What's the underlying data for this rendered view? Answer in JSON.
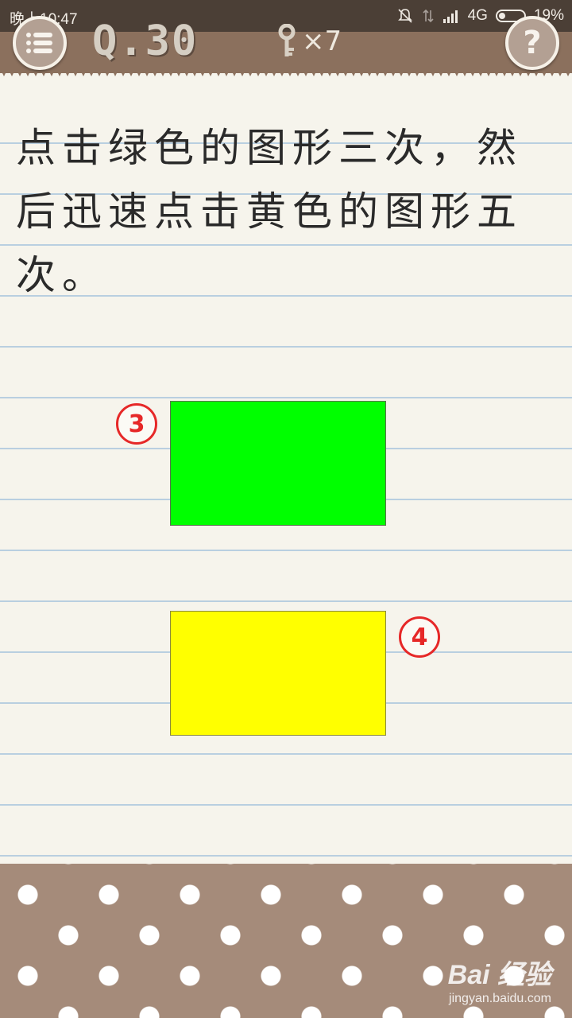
{
  "status_bar": {
    "time": "晚上10:47",
    "network": "4G",
    "battery": "19%",
    "icons": [
      "bell-muted-icon",
      "data-arrows-icon",
      "signal-icon",
      "battery-icon"
    ]
  },
  "header": {
    "level": "Q.30",
    "keys_count": "×7",
    "help_glyph": "?",
    "icons": [
      "menu-list-icon",
      "key-icon",
      "help-icon"
    ]
  },
  "question": {
    "text": "点击绿色的图形三次，然后迅速点击黄色的图形五次。"
  },
  "shapes": {
    "green": {
      "color": "#00ff00"
    },
    "yellow": {
      "color": "#ffff00"
    }
  },
  "annotations": {
    "green_badge": "3",
    "yellow_badge": "4",
    "color": "#e62828"
  },
  "watermark": {
    "logo": "Bai 经验",
    "url": "jingyan.baidu.com"
  }
}
